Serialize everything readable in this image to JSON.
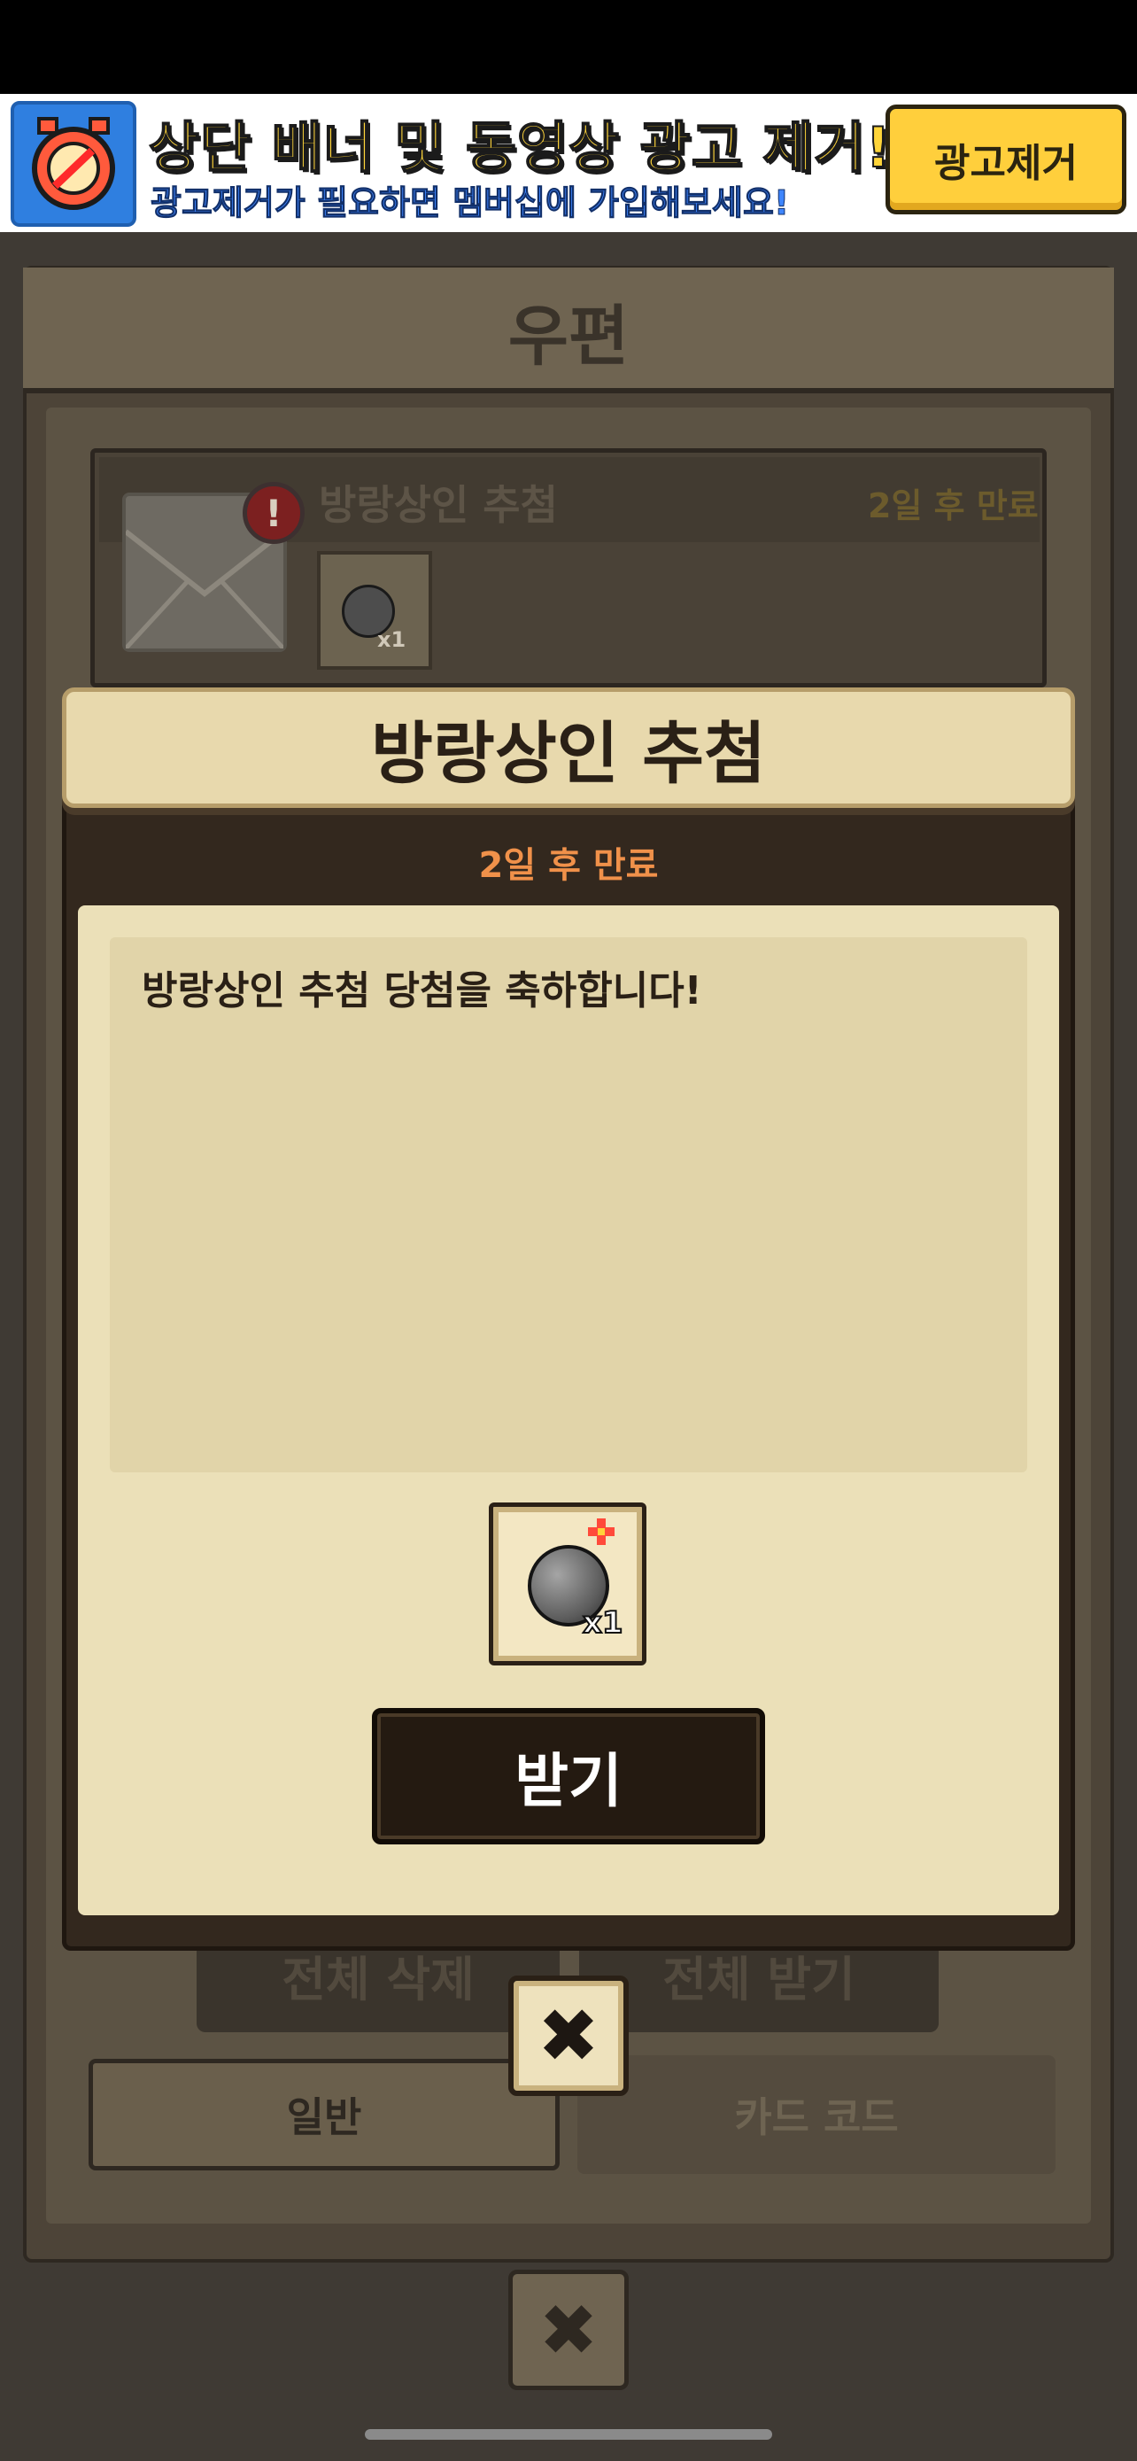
{
  "ad_banner": {
    "title": "상단 배너 및 동영상 광고 제거!",
    "subtitle": "광고제거가 필요하면 멤버십에 가입해보세요!",
    "remove_button": "광고제거"
  },
  "mailbox": {
    "title": "우편",
    "items": [
      {
        "title": "방랑상인 추첨",
        "expire": "2일 후 만료",
        "reward_qty": "x1"
      }
    ],
    "buttons": {
      "delete_all": "전체 삭제",
      "receive_all": "전체 받기"
    },
    "tabs": [
      "일반",
      "카드 코드"
    ]
  },
  "modal": {
    "title": "방랑상인 추첨",
    "expire": "2일 후 만료",
    "message": "방랑상인 추첨 당첨을 축하합니다!",
    "reward_qty": "x1",
    "receive_button": "받기"
  },
  "colors": {
    "accent_orange": "#f0914a",
    "paper": "#ebe0b8",
    "ad_yellow": "#ffd53a",
    "ad_blue": "#3f86ff"
  },
  "icons": {
    "ad": "no-ads-alarm-icon",
    "alert": "exclamation-icon",
    "reward": "bomb-icon",
    "close": "close-icon"
  }
}
